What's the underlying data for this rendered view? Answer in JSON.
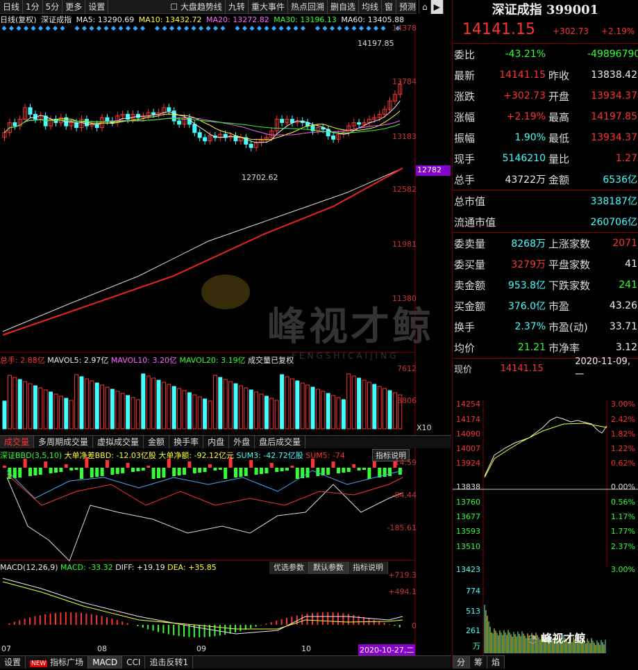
{
  "toolbar": {
    "items": [
      "日线",
      "1分",
      "5分",
      "更多",
      "设置"
    ],
    "right": [
      "大盘趋势线",
      "九转",
      "重大事件",
      "热点回溯",
      "删自选",
      "均线",
      "窗",
      "预测"
    ]
  },
  "ma": {
    "label": "日线(复权)",
    "name": "深证成指",
    "ma5": "MA5: 13290.69",
    "ma10": "MA10: 13432.72",
    "ma20": "MA20: 13272.82",
    "ma30": "MA30: 13196.13",
    "ma60": "MA60: 13405.88"
  },
  "price_axis": [
    "14378",
    "13784",
    "13183",
    "12782",
    "12582",
    "11981",
    "11380"
  ],
  "annotations": {
    "high": "14197.85",
    "low": "12702.62"
  },
  "vol": {
    "zongshou": "总手: 2.88亿",
    "mavol5": "MAVOL5: 2.97亿",
    "mavol10": "MAVOL10: 3.20亿",
    "mavol20": "MAVOL20: 3.19亿",
    "note": "成交量已复权",
    "axis": [
      "7612",
      "3806",
      "X10"
    ]
  },
  "vol_tabs": [
    "成交量",
    "多周期成交量",
    "虚拟成交量",
    "金额",
    "换手率",
    "内盘",
    "外盘",
    "盘后成交量"
  ],
  "bbd": {
    "title": "深证BBD(3,5,10)",
    "net": "大单净差BBD: -12.03亿股",
    "amt": "大单净额: -92.12亿元",
    "sum3": "SUM3: -42.72亿股",
    "sum5": "SUM5: -74",
    "help": "指标说明",
    "axis": [
      "14.59",
      "-84.44",
      "-185.61"
    ]
  },
  "macd": {
    "title": "MACD(12,26,9)",
    "macd": "MACD: -33.32",
    "diff": "DIFF: +19.19",
    "dea": "DEA: +35.85",
    "btn1": "优选参数",
    "btn2": "默认参数",
    "btn3": "指标说明",
    "axis": [
      "+719.3",
      "+494.1",
      "0"
    ]
  },
  "months": [
    "07",
    "08",
    "09",
    "10"
  ],
  "date_tag": "2020-10-27,二",
  "bottom_tabs": [
    "设置",
    "指标广场",
    "MACD",
    "CCI",
    "追击反转1"
  ],
  "new_badge": "NEW",
  "right": {
    "title": "深证成指 399001",
    "price": "14141.15",
    "chg": "+302.73",
    "pct": "+2.19%",
    "rows": [
      [
        "委比",
        "-43.21%",
        "",
        "-49896790"
      ],
      [
        "最新",
        "14141.15",
        "昨收",
        "13838.42"
      ],
      [
        "涨跌",
        "+302.73",
        "开盘",
        "13934.37"
      ],
      [
        "涨幅",
        "+2.19%",
        "最高",
        "14197.85"
      ],
      [
        "振幅",
        "1.90%",
        "最低",
        "13934.37"
      ],
      [
        "现手",
        "5146210",
        "量比",
        "1.27"
      ],
      [
        "总手",
        "43722万",
        "金额",
        "6536亿"
      ]
    ],
    "mv": [
      [
        "总市值",
        "338187亿"
      ],
      [
        "流通市值",
        "260706亿"
      ]
    ],
    "rows2": [
      [
        "委卖量",
        "8268万",
        "上涨家数",
        "2071"
      ],
      [
        "委买量",
        "3279万",
        "平盘家数",
        "41"
      ],
      [
        "卖金额",
        "953.8亿",
        "下跌家数",
        "241"
      ],
      [
        "买金额",
        "376.0亿",
        "市盈",
        "43.26"
      ],
      [
        "换手",
        "2.37%",
        "市盈(动)",
        "33.71"
      ],
      [
        "均价",
        "21.21",
        "市净率",
        "3.12"
      ]
    ],
    "mini_title": "现价",
    "mini_price": "14141.15",
    "mini_date": "2020-11-09,一",
    "mini_left": [
      "14254",
      "14174",
      "14090",
      "14007",
      "13924",
      "13838",
      "13760",
      "13677",
      "13593",
      "13510",
      "13423",
      "774",
      "513",
      "261",
      "万"
    ],
    "mini_right": [
      "3.00%",
      "2.42%",
      "1.82%",
      "1.22%",
      "0.62%",
      "0.00%",
      "0.56%",
      "1.17%",
      "1.77%",
      "2.37%",
      "3.00%"
    ],
    "tabs": [
      "分",
      "筹",
      "焰"
    ]
  },
  "watermark": "峰视才鲸",
  "watermark_sub": "FENGSHICAIJING",
  "wechat": "峰视才鲸"
}
